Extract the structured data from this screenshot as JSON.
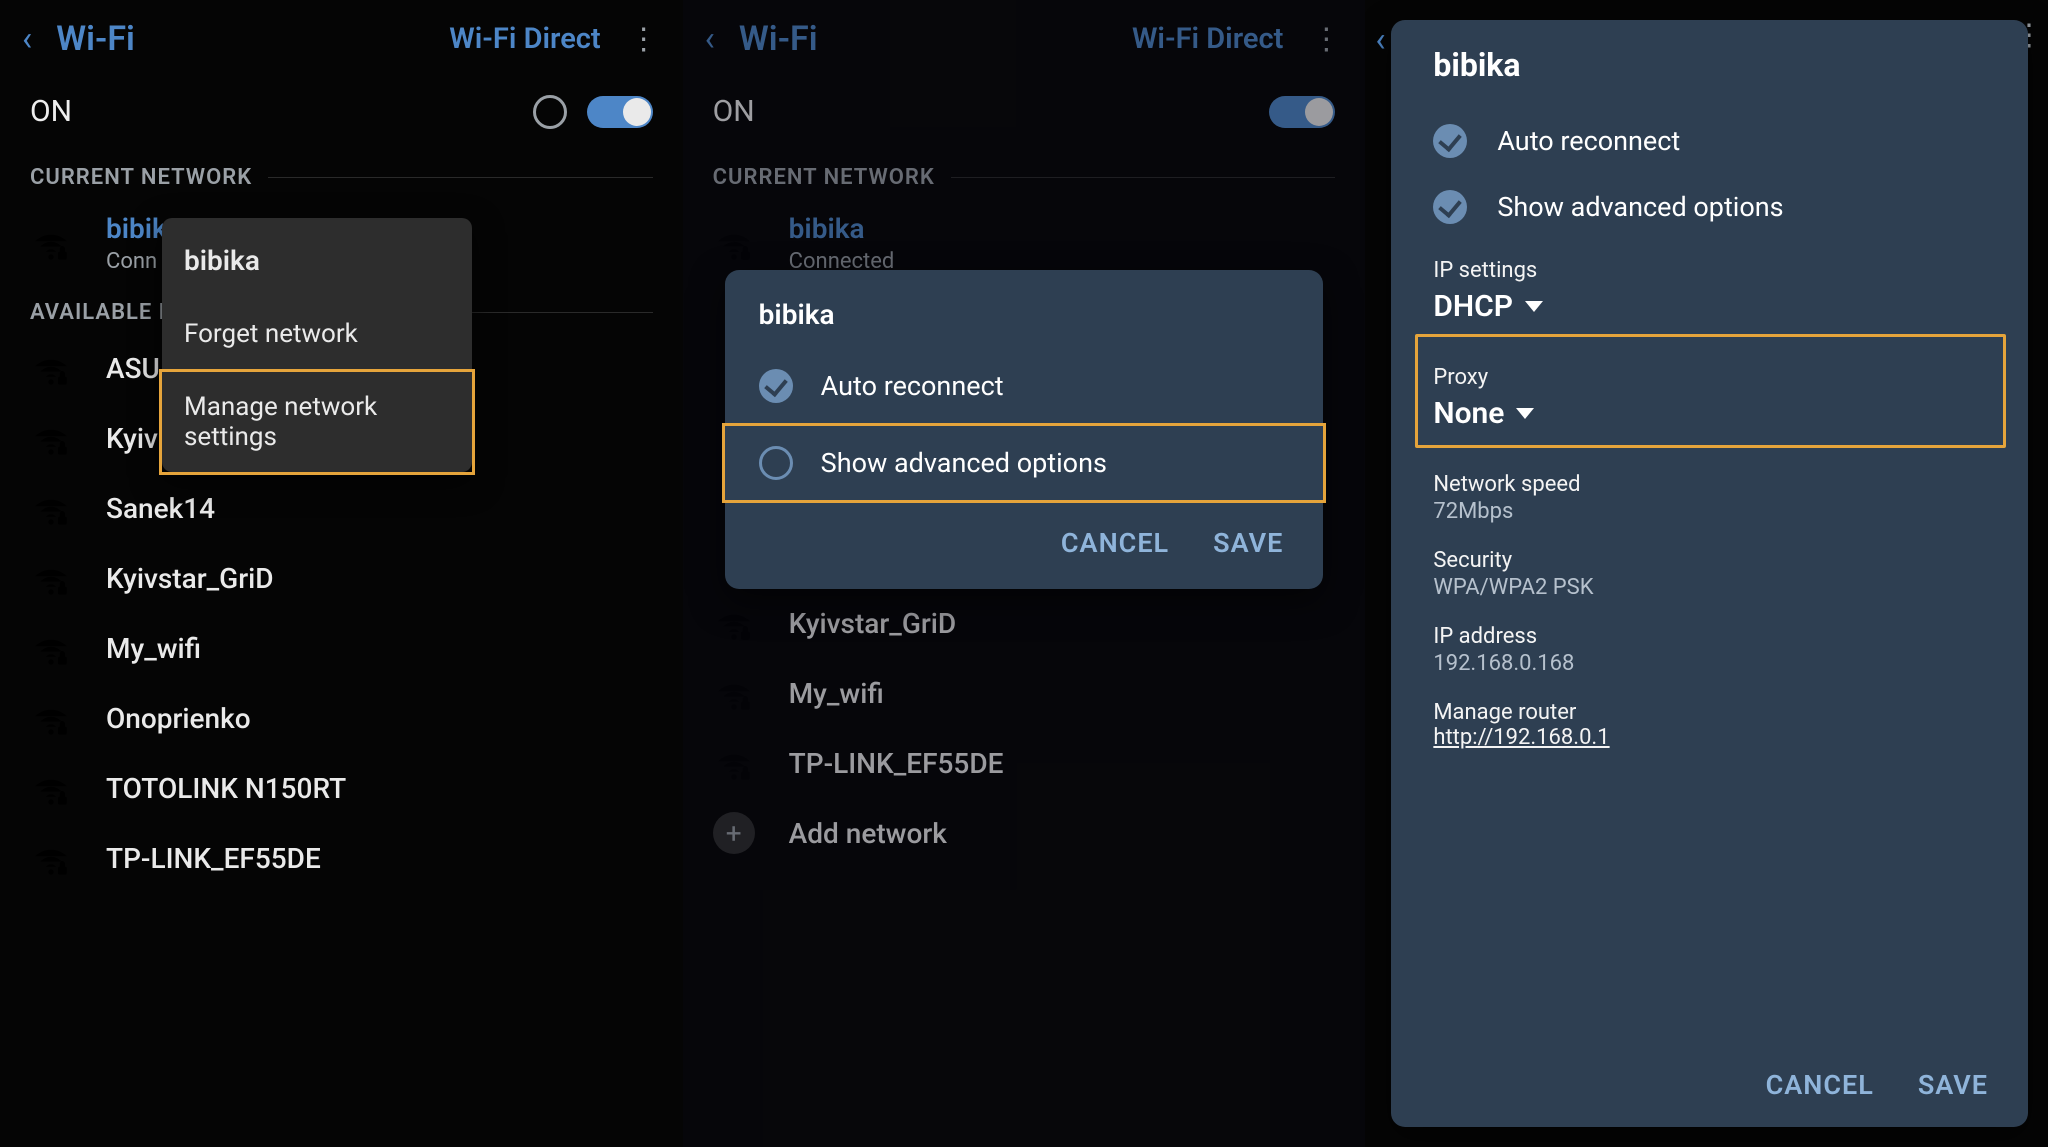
{
  "shared": {
    "appbar": {
      "title": "Wi-Fi",
      "wifi_direct": "Wi-Fi Direct",
      "kebab": "⋮",
      "back": "‹"
    },
    "on_label": "ON",
    "sect_current": "CURRENT NETWORK",
    "sect_available": "AVAILABLE NETWORKS"
  },
  "pane1": {
    "current": {
      "name": "bibika",
      "sub": "Conn"
    },
    "avail_heading_trimmed": "AVAILABLE NE",
    "available": [
      "ASU",
      "Kyiv",
      "Sanek14",
      "Kyivstar_GriD",
      "My_wifi",
      "Onoprienko",
      "TOTOLINK N150RT",
      "TP-LINK_EF55DE"
    ],
    "ctx": {
      "header": "bibika",
      "forget": "Forget network",
      "manage": "Manage network settings"
    }
  },
  "pane2": {
    "current": {
      "name": "bibika",
      "sub": "Connected"
    },
    "available": [
      "Kyivstar_GriD",
      "My_wifi",
      "TP-LINK_EF55DE"
    ],
    "add_network": "Add network",
    "dlg": {
      "header": "bibika",
      "auto_reconnect": "Auto reconnect",
      "show_advanced": "Show advanced options",
      "cancel": "CANCEL",
      "save": "SAVE"
    }
  },
  "pane3": {
    "header": "bibika",
    "auto_reconnect": "Auto reconnect",
    "show_advanced": "Show advanced options",
    "ip_settings_label": "IP settings",
    "ip_settings_value": "DHCP",
    "proxy_label": "Proxy",
    "proxy_value": "None",
    "network_speed_label": "Network speed",
    "network_speed_value": "72Mbps",
    "security_label": "Security",
    "security_value": "WPA/WPA2 PSK",
    "ip_address_label": "IP address",
    "ip_address_value": "192.168.0.168",
    "manage_router_label": "Manage router",
    "manage_router_link": "http://192.168.0.1",
    "cancel": "CANCEL",
    "save": "SAVE"
  }
}
